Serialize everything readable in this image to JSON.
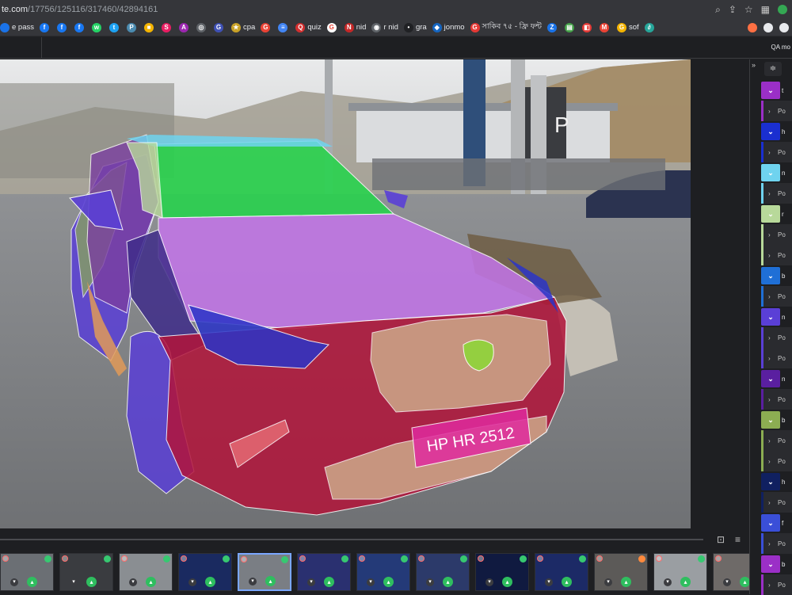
{
  "browser": {
    "url_visible": "te.com",
    "url_path": "/17756/125116/317460/42894161"
  },
  "bookmarks": [
    {
      "label": "e pass",
      "color": "#1a73e8",
      "glyph": ""
    },
    {
      "label": "",
      "color": "#1877f2",
      "glyph": "f"
    },
    {
      "label": "",
      "color": "#1877f2",
      "glyph": "f"
    },
    {
      "label": "",
      "color": "#1877f2",
      "glyph": "f"
    },
    {
      "label": "",
      "color": "#25d366",
      "glyph": "w"
    },
    {
      "label": "",
      "color": "#1da1f2",
      "glyph": "t"
    },
    {
      "label": "",
      "color": "#4b8bb0",
      "glyph": "P"
    },
    {
      "label": "",
      "color": "#f4b400",
      "glyph": "■"
    },
    {
      "label": "",
      "color": "#e91e63",
      "glyph": "S"
    },
    {
      "label": "",
      "color": "#9c27b0",
      "glyph": "A"
    },
    {
      "label": "",
      "color": "#5f6368",
      "glyph": "◎"
    },
    {
      "label": "",
      "color": "#3f51b5",
      "glyph": "G"
    },
    {
      "label": "cpa",
      "color": "#c9a227",
      "glyph": "★"
    },
    {
      "label": "",
      "color": "#ea4335",
      "glyph": "G"
    },
    {
      "label": "",
      "color": "#4285f4",
      "glyph": "≡"
    },
    {
      "label": "quiz",
      "color": "#d32f2f",
      "glyph": "Q"
    },
    {
      "label": "",
      "color": "#ffffff",
      "glyph": "G"
    },
    {
      "label": "nid",
      "color": "#c62828",
      "glyph": "N"
    },
    {
      "label": "r nid",
      "color": "#5f6368",
      "glyph": "◉"
    },
    {
      "label": "gra",
      "color": "#202124",
      "glyph": "•"
    },
    {
      "label": "jonmo",
      "color": "#1565c0",
      "glyph": "◆"
    },
    {
      "label": "সাকিব ৭৫ - ফ্রি ফন্ট",
      "color": "#e53935",
      "glyph": "G"
    },
    {
      "label": "",
      "color": "#1a73e8",
      "glyph": "Z"
    },
    {
      "label": "",
      "color": "#43a047",
      "glyph": "▤"
    },
    {
      "label": "",
      "color": "#e53935",
      "glyph": "◧"
    },
    {
      "label": "",
      "color": "#ea4335",
      "glyph": "M"
    },
    {
      "label": "sof",
      "color": "#f4b400",
      "glyph": "G"
    },
    {
      "label": "",
      "color": "#26a69a",
      "glyph": "∂"
    }
  ],
  "app": {
    "top_right_label": "QA mo"
  },
  "right_panel": {
    "rows": [
      {
        "kind": "head",
        "color": "#9b2fc7",
        "text": "t"
      },
      {
        "kind": "sub",
        "color": "#9b2fc7",
        "text": "Po"
      },
      {
        "kind": "head",
        "color": "#1a2fd0",
        "text": "h"
      },
      {
        "kind": "sub",
        "color": "#1a2fd0",
        "text": "Po"
      },
      {
        "kind": "head",
        "color": "#6fd3ef",
        "text": "n"
      },
      {
        "kind": "sub",
        "color": "#6fd3ef",
        "text": "Po"
      },
      {
        "kind": "head",
        "color": "#b8d99a",
        "text": "r"
      },
      {
        "kind": "sub",
        "color": "#b8d99a",
        "text": "Po"
      },
      {
        "kind": "sub",
        "color": "#b8d99a",
        "text": "Po"
      },
      {
        "kind": "head",
        "color": "#1f6fd6",
        "text": "b"
      },
      {
        "kind": "sub",
        "color": "#1f6fd6",
        "text": "Po"
      },
      {
        "kind": "head",
        "color": "#5a3fd6",
        "text": "n"
      },
      {
        "kind": "sub",
        "color": "#5a3fd6",
        "text": "Po"
      },
      {
        "kind": "sub",
        "color": "#5a3fd6",
        "text": "Po"
      },
      {
        "kind": "head",
        "color": "#5a1fa0",
        "text": "n"
      },
      {
        "kind": "sub",
        "color": "#5a1fa0",
        "text": "Po"
      },
      {
        "kind": "head",
        "color": "#8cad52",
        "text": "b"
      },
      {
        "kind": "sub",
        "color": "#8cad52",
        "text": "Po"
      },
      {
        "kind": "sub",
        "color": "#8cad52",
        "text": "Po"
      },
      {
        "kind": "head",
        "color": "#102060",
        "text": "h"
      },
      {
        "kind": "sub",
        "color": "#102060",
        "text": "Po"
      },
      {
        "kind": "head",
        "color": "#3a4fd8",
        "text": "f"
      },
      {
        "kind": "sub",
        "color": "#3a4fd8",
        "text": "Po"
      },
      {
        "kind": "head",
        "color": "#9b2fc7",
        "text": "b"
      },
      {
        "kind": "sub",
        "color": "#9b2fc7",
        "text": "Po"
      }
    ]
  },
  "canvas": {
    "plate_text": "HP HR 2512"
  },
  "thumbnails": [
    {
      "bg": "#6b6f74",
      "status": "green",
      "active": false
    },
    {
      "bg": "#3a3c40",
      "status": "green",
      "active": false
    },
    {
      "bg": "#8a8e92",
      "status": "green",
      "active": false
    },
    {
      "bg": "#1a2a60",
      "status": "green",
      "active": false
    },
    {
      "bg": "#7a7e84",
      "status": "green",
      "active": true
    },
    {
      "bg": "#2a3070",
      "status": "green",
      "active": false
    },
    {
      "bg": "#243a78",
      "status": "green",
      "active": false
    },
    {
      "bg": "#2c3a6a",
      "status": "green",
      "active": false
    },
    {
      "bg": "#101a40",
      "status": "green",
      "active": false
    },
    {
      "bg": "#1c2a66",
      "status": "green",
      "active": false
    },
    {
      "bg": "#5c5a58",
      "status": "orange",
      "active": false
    },
    {
      "bg": "#9a9ea2",
      "status": "green",
      "active": false
    },
    {
      "bg": "#6e6a68",
      "status": "green",
      "active": false
    }
  ]
}
